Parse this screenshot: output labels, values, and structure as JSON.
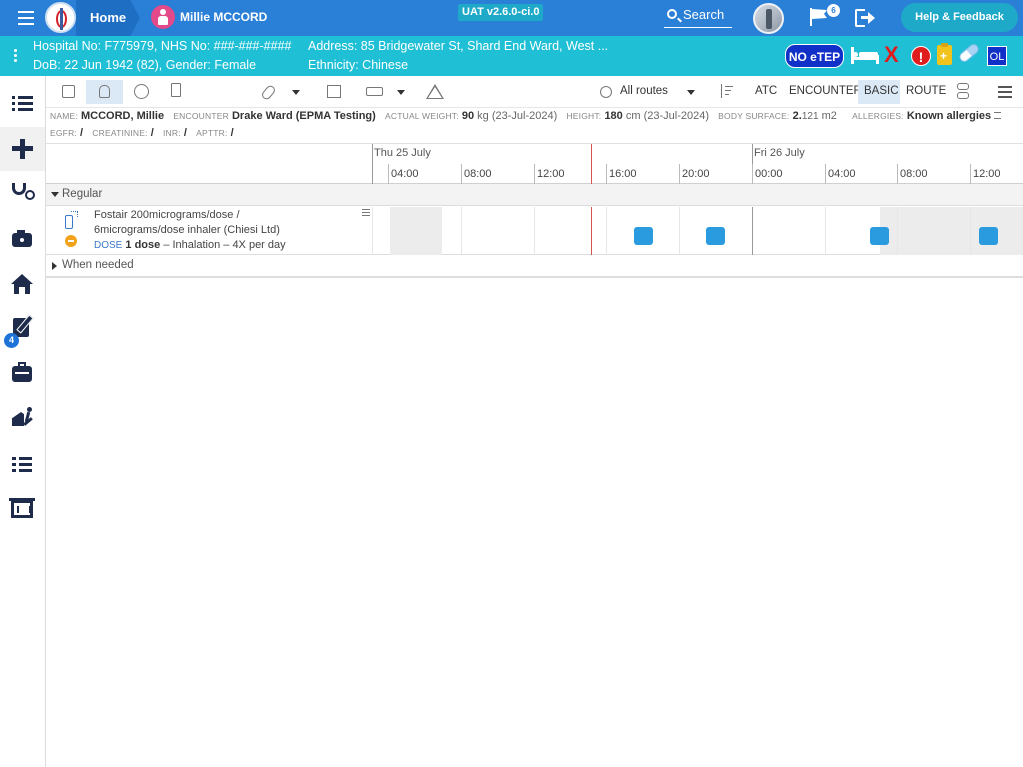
{
  "topbar": {
    "home_label": "Home",
    "patient_name": "Millie MCCORD",
    "version": "UAT v2.6.0-ci.0",
    "search_label": "Search",
    "flag_count": "6",
    "help_label": "Help & Feedback",
    "icons": [
      "menu-icon",
      "app-logo",
      "patient-female-icon",
      "search-icon",
      "user-avatar",
      "flag-icon",
      "logout-icon"
    ]
  },
  "banner": {
    "line1_left": "Hospital No: F775979, NHS No: ###-###-####",
    "line1_right": "Address: 85 Bridgewater St, Shard End Ward, West ...",
    "line2_left": "DoB: 22 Jun 1942 (82), Gender: Female",
    "line2_right": "Ethnicity: Chinese",
    "noetep_label": "NO eTEP",
    "ol_label": "OL",
    "alert_symbol": "!",
    "x_symbol": "X",
    "colors": {
      "banner_bg": "#1fbfd6",
      "topbar_bg": "#2a7fd6",
      "alert_red": "#e01d1d",
      "badge_blue": "#1030c8"
    }
  },
  "sidebar": {
    "items": [
      {
        "name": "list-icon"
      },
      {
        "name": "plus-icon"
      },
      {
        "name": "stethoscope-icon"
      },
      {
        "name": "camera-icon"
      },
      {
        "name": "home-icon"
      },
      {
        "name": "prescription-icon",
        "badge": "4"
      },
      {
        "name": "briefcase-icon"
      },
      {
        "name": "discharge-icon"
      },
      {
        "name": "checklist-icon"
      },
      {
        "name": "display-icon"
      }
    ]
  },
  "toolbar": {
    "routes_label": "All routes",
    "atc_label": "ATC",
    "encounter_label": "ENCOUNTER",
    "basic_label": "BASIC",
    "route_label": "ROUTE"
  },
  "info": {
    "name_label": "NAME:",
    "name_value": "MCCORD, Millie",
    "encounter_label": "ENCOUNTER",
    "encounter_value": "Drake Ward (EPMA Testing)",
    "weight_label": "ACTUAL WEIGHT:",
    "weight_value": "90",
    "weight_unit": "kg (23-Jul-2024)",
    "height_label": "HEIGHT:",
    "height_value": "180",
    "height_unit": "cm (23-Jul-2024)",
    "surface_label": "BODY SURFACE:",
    "surface_value": "2.",
    "surface_decimals": "121",
    "surface_unit": "m2",
    "allergies_label": "ALLERGIES:",
    "allergies_value": "Known allergies",
    "egfr_label": "EGFR:",
    "egfr_value": "/",
    "creatinine_label": "CREATININE:",
    "creatinine_value": "/",
    "inr_label": "INR:",
    "inr_value": "/",
    "apttr_label": "APTTR:",
    "apttr_value": "/"
  },
  "timeline": {
    "days": [
      "Thu 25 July",
      "Fri 26 July"
    ],
    "hours": [
      "04:00",
      "08:00",
      "12:00",
      "16:00",
      "20:00",
      "00:00",
      "04:00",
      "08:00",
      "12:00"
    ]
  },
  "groups": {
    "regular_label": "Regular",
    "when_needed_label": "When needed"
  },
  "medication": {
    "name_line1": "Fostair 200micrograms/dose /",
    "name_line2": "6micrograms/dose inhaler (Chiesi Ltd)",
    "dose_label": "DOSE",
    "dose_value": "1 dose",
    "dose_rest": "– Inhalation – 4X per day",
    "administrations_count": 4
  }
}
